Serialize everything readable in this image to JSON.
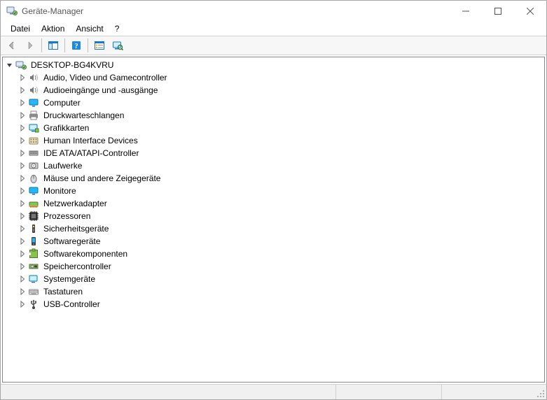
{
  "window": {
    "title": "Geräte-Manager"
  },
  "menu": {
    "items": [
      "Datei",
      "Aktion",
      "Ansicht",
      "?"
    ]
  },
  "toolbar": {
    "back": "back-icon",
    "forward": "forward-icon",
    "show_hide": "show-hide-tree-icon",
    "help": "help-icon",
    "properties": "properties-icon",
    "scan": "scan-hardware-icon"
  },
  "tree": {
    "root": {
      "label": "DESKTOP-BG4KVRU",
      "expanded": true,
      "icon": "computer-root"
    },
    "children": [
      {
        "label": "Audio, Video und Gamecontroller",
        "icon": "speaker"
      },
      {
        "label": "Audioeingänge und -ausgänge",
        "icon": "speaker"
      },
      {
        "label": "Computer",
        "icon": "monitor"
      },
      {
        "label": "Druckwarteschlangen",
        "icon": "printer"
      },
      {
        "label": "Grafikkarten",
        "icon": "display-adapter"
      },
      {
        "label": "Human Interface Devices",
        "icon": "hid"
      },
      {
        "label": "IDE ATA/ATAPI-Controller",
        "icon": "ide"
      },
      {
        "label": "Laufwerke",
        "icon": "drive"
      },
      {
        "label": "Mäuse und andere Zeigegeräte",
        "icon": "mouse"
      },
      {
        "label": "Monitore",
        "icon": "monitor"
      },
      {
        "label": "Netzwerkadapter",
        "icon": "network"
      },
      {
        "label": "Prozessoren",
        "icon": "cpu"
      },
      {
        "label": "Sicherheitsgeräte",
        "icon": "security"
      },
      {
        "label": "Softwaregeräte",
        "icon": "software-device"
      },
      {
        "label": "Softwarekomponenten",
        "icon": "software-component"
      },
      {
        "label": "Speichercontroller",
        "icon": "storage-controller"
      },
      {
        "label": "Systemgeräte",
        "icon": "system-device"
      },
      {
        "label": "Tastaturen",
        "icon": "keyboard"
      },
      {
        "label": "USB-Controller",
        "icon": "usb"
      }
    ]
  }
}
